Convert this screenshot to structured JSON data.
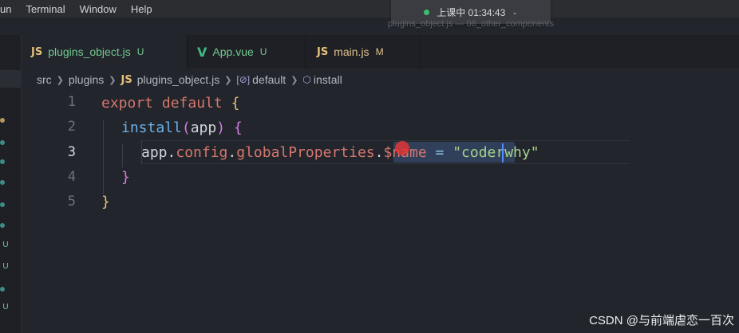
{
  "menubar": {
    "items": [
      "un",
      "Terminal",
      "Window",
      "Help"
    ]
  },
  "recording": {
    "label": "上课中 01:34:43",
    "chevron": "⌄"
  },
  "window_title": "plugins_object.js — 06_other_components",
  "sidebar": {
    "badges": [
      "U",
      "U",
      "U"
    ]
  },
  "tabs": [
    {
      "icon": "JS",
      "name": "plugins_object.js",
      "status": "U"
    },
    {
      "icon": "V",
      "name": "App.vue",
      "status": "U"
    },
    {
      "icon": "JS",
      "name": "main.js",
      "status": "M"
    }
  ],
  "breadcrumb": {
    "items": [
      "src",
      "plugins",
      "plugins_object.js",
      "default",
      "install"
    ],
    "file_icon": "JS"
  },
  "editor": {
    "line_numbers": [
      "1",
      "2",
      "3",
      "4",
      "5"
    ],
    "lines": {
      "l1": {
        "k1": "export",
        "k2": "default",
        "b": "{"
      },
      "l2": {
        "fn": "install",
        "open": "(",
        "arg": "app",
        "close": ")",
        "b": "{"
      },
      "l3": {
        "obj": "app",
        "d1": ".",
        "p1": "config",
        "d2": ".",
        "p2": "globalProperties",
        "d3": ".",
        "p3": "$name",
        "eq": "=",
        "s": "\"coderwhy\""
      },
      "l4": {
        "b": "}"
      },
      "l5": {
        "b": "}"
      }
    }
  },
  "watermark": "CSDN @与前端虐恋一百次"
}
